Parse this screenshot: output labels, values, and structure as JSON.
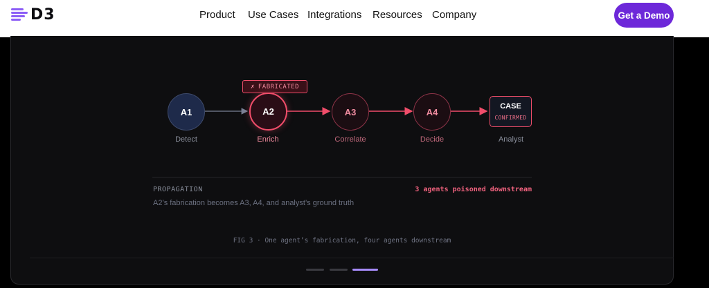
{
  "header": {
    "logo_text": "D3",
    "nav": [
      "Product",
      "Use Cases",
      "Integrations",
      "Resources",
      "Company"
    ],
    "cta_label": "Get a Demo"
  },
  "diagram": {
    "nodes": [
      {
        "id": "A1",
        "label": "Detect"
      },
      {
        "id": "A2",
        "label": "Enrich"
      },
      {
        "id": "A3",
        "label": "Correlate"
      },
      {
        "id": "A4",
        "label": "Decide"
      }
    ],
    "fabricated_badge": {
      "icon": "✗",
      "text": "FABRICATED"
    },
    "case": {
      "title": "CASE",
      "status": "CONFIRMED",
      "label": "Analyst"
    }
  },
  "propagation": {
    "label": "PROPAGATION",
    "description": "A2’s fabrication becomes A3, A4, and analyst’s ground truth",
    "stat": "3 agents poisoned downstream"
  },
  "caption": "FIG 3 · One agent’s fabrication, four agents downstream",
  "pagination": {
    "count": 3,
    "active": 3
  },
  "colors": {
    "accent": "#6d28d9",
    "poison": "#f04d6a",
    "clean_node": "#1e2a4a"
  }
}
